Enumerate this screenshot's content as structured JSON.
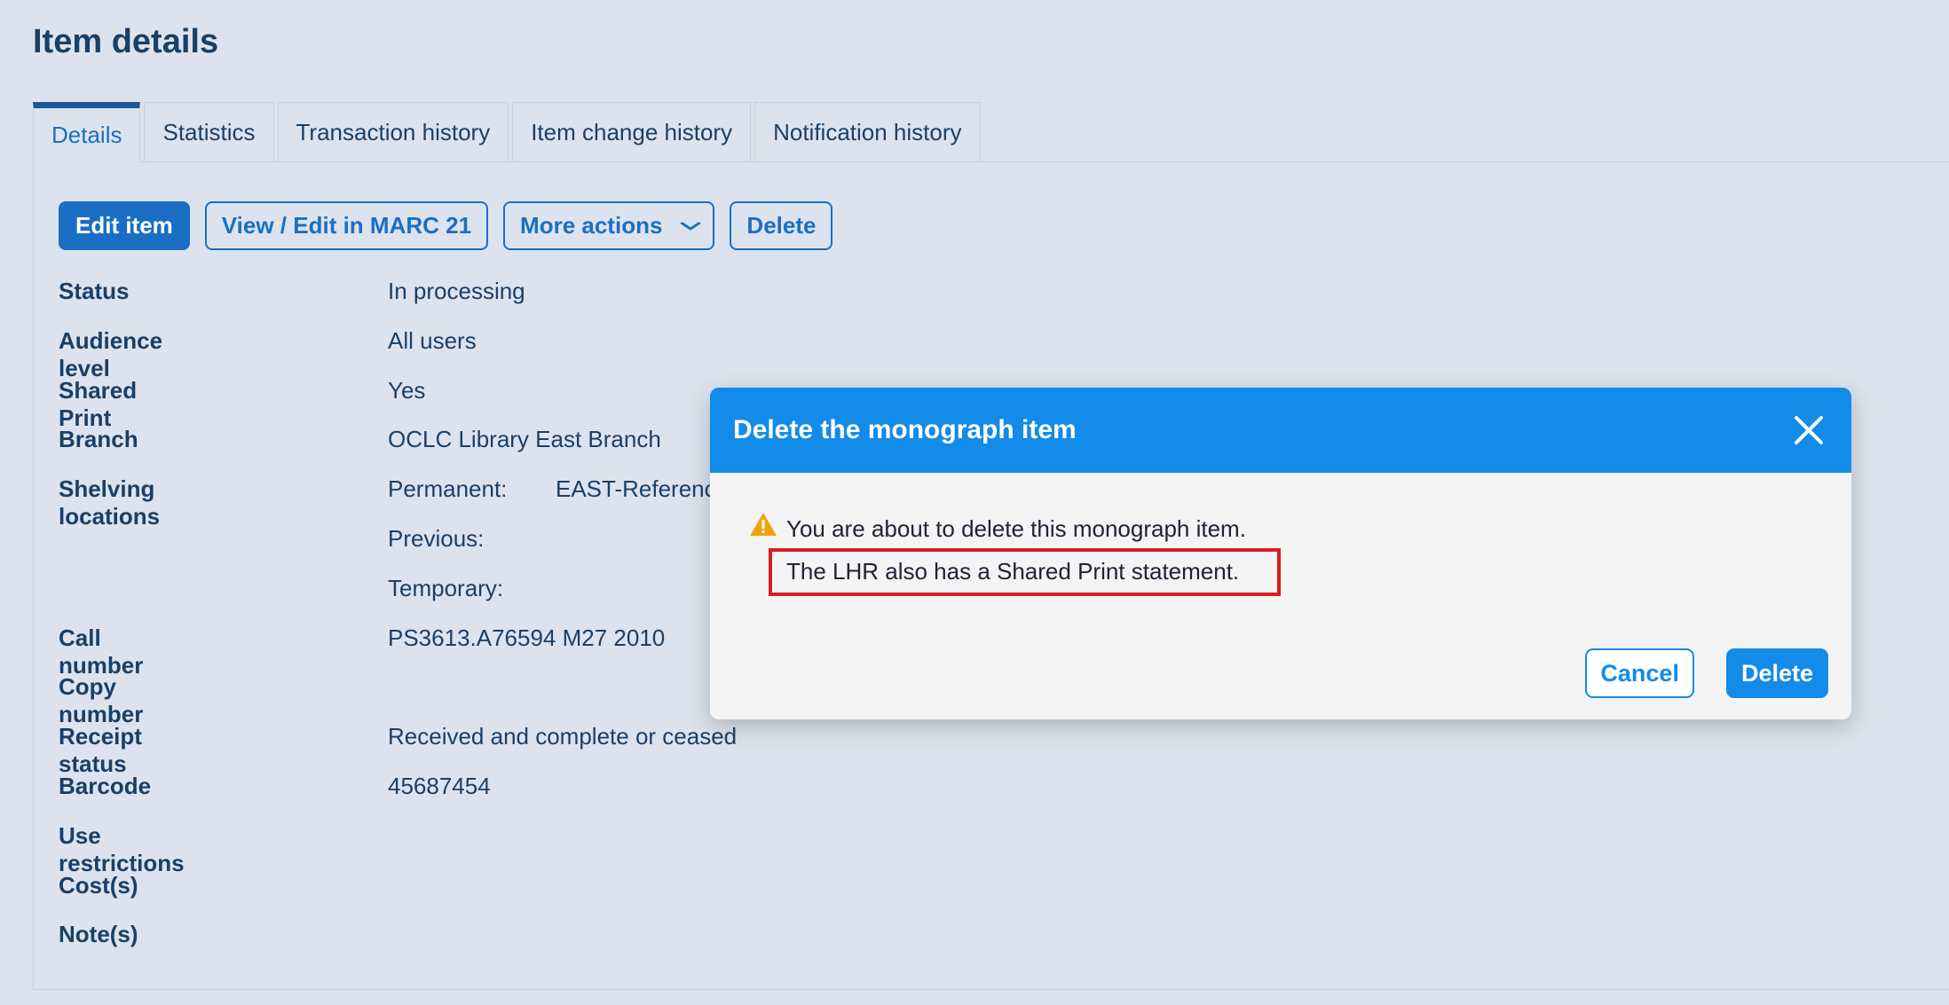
{
  "page": {
    "title": "Item details"
  },
  "tabs": [
    {
      "label": "Details",
      "active": true
    },
    {
      "label": "Statistics"
    },
    {
      "label": "Transaction history"
    },
    {
      "label": "Item change history"
    },
    {
      "label": "Notification history"
    }
  ],
  "toolbar": {
    "edit_item": "Edit item",
    "view_marc": "View / Edit in MARC 21",
    "more_actions": "More actions",
    "delete": "Delete"
  },
  "fields": {
    "status": {
      "label": "Status",
      "value": "In processing"
    },
    "audience": {
      "label": "Audience level",
      "value": "All users"
    },
    "shared_print": {
      "label": "Shared Print",
      "value": "Yes"
    },
    "branch": {
      "label": "Branch",
      "value": "OCLC Library East Branch"
    },
    "shelving": {
      "label": "Shelving locations",
      "permanent_label": "Permanent:",
      "permanent_value": "EAST-Reference",
      "previous_label": "Previous:",
      "temporary_label": "Temporary:"
    },
    "call_number": {
      "label": "Call number",
      "value": "PS3613.A76594 M27 2010"
    },
    "copy_number": {
      "label": "Copy number",
      "value": ""
    },
    "receipt_status": {
      "label": "Receipt status",
      "value": "Received and complete or ceased"
    },
    "barcode": {
      "label": "Barcode",
      "value": "45687454"
    },
    "use_restrictions": {
      "label": "Use restrictions",
      "value": ""
    },
    "costs": {
      "label": "Cost(s)",
      "value": ""
    },
    "notes": {
      "label": "Note(s)",
      "value": ""
    }
  },
  "modal": {
    "title": "Delete the monograph item",
    "message": "You are about to delete this monograph item.",
    "highlighted_message": "The LHR also has a Shared Print statement.",
    "cancel": "Cancel",
    "delete": "Delete",
    "colors": {
      "header": "#138be8",
      "warning": "#f0a30a",
      "highlight_border": "#d81e1e"
    }
  }
}
